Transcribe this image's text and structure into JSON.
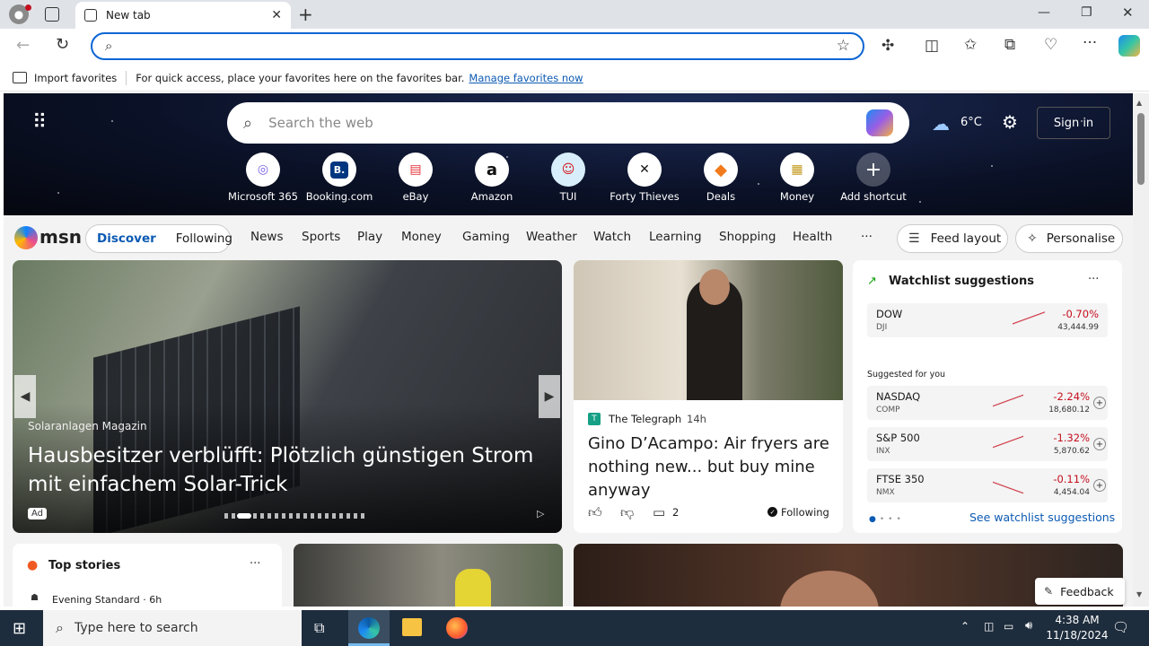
{
  "browser": {
    "tab_title": "New tab",
    "address_value": "",
    "favbar": {
      "import_label": "Import favorites",
      "hint": "For quick access, place your favorites here on the favorites bar.",
      "manage_link": "Manage favorites now"
    }
  },
  "hero": {
    "search_placeholder": "Search the web",
    "weather_temp": "6°C",
    "sign_in": "Sign in",
    "shortcuts": [
      {
        "label": "Microsoft 365",
        "glyph": "◎"
      },
      {
        "label": "Booking.com",
        "glyph": "B."
      },
      {
        "label": "eBay",
        "glyph": "▤"
      },
      {
        "label": "Amazon",
        "glyph": "a"
      },
      {
        "label": "TUI",
        "glyph": "☺"
      },
      {
        "label": "Forty Thieves",
        "glyph": "✕"
      },
      {
        "label": "Deals",
        "glyph": "◆"
      },
      {
        "label": "Money",
        "glyph": "▦"
      },
      {
        "label": "Add shortcut",
        "glyph": "+"
      }
    ]
  },
  "nav": {
    "logo": "msn",
    "discover": "Discover",
    "following": "Following",
    "categories": [
      "News",
      "Sports",
      "Play",
      "Money",
      "Gaming",
      "Weather",
      "Watch",
      "Learning",
      "Shopping",
      "Health"
    ],
    "more": "···",
    "feed_layout": "Feed layout",
    "personalise": "Personalise"
  },
  "featured": {
    "source": "Solaranlagen Magazin",
    "title": "Hausbesitzer verblüfft: Plötzlich günstigen Strom mit einfachem Solar-Trick",
    "ad": "Ad"
  },
  "article": {
    "source": "The Telegraph",
    "age": "14h",
    "title": "Gino D’Acampo: Air fryers are nothing new... but buy mine anyway",
    "comments": "2",
    "following": "Following"
  },
  "watchlist": {
    "title": "Watchlist suggestions",
    "suggested_label": "Suggested for you",
    "link": "See watchlist suggestions",
    "top": {
      "name": "DOW",
      "sym": "DJI",
      "pct": "-0.70%",
      "val": "43,444.99"
    },
    "items": [
      {
        "name": "NASDAQ",
        "sym": "COMP",
        "pct": "-2.24%",
        "val": "18,680.12"
      },
      {
        "name": "S&P 500",
        "sym": "INX",
        "pct": "-1.32%",
        "val": "5,870.62"
      },
      {
        "name": "FTSE 350",
        "sym": "NMX",
        "pct": "-0.11%",
        "val": "4,454.04"
      }
    ]
  },
  "bottom": {
    "top_stories": "Top stories",
    "top_source": "Evening Standard · 6h",
    "feedback": "Feedback"
  },
  "taskbar": {
    "search_placeholder": "Type here to search",
    "time": "4:38 AM",
    "date": "11/18/2024"
  }
}
